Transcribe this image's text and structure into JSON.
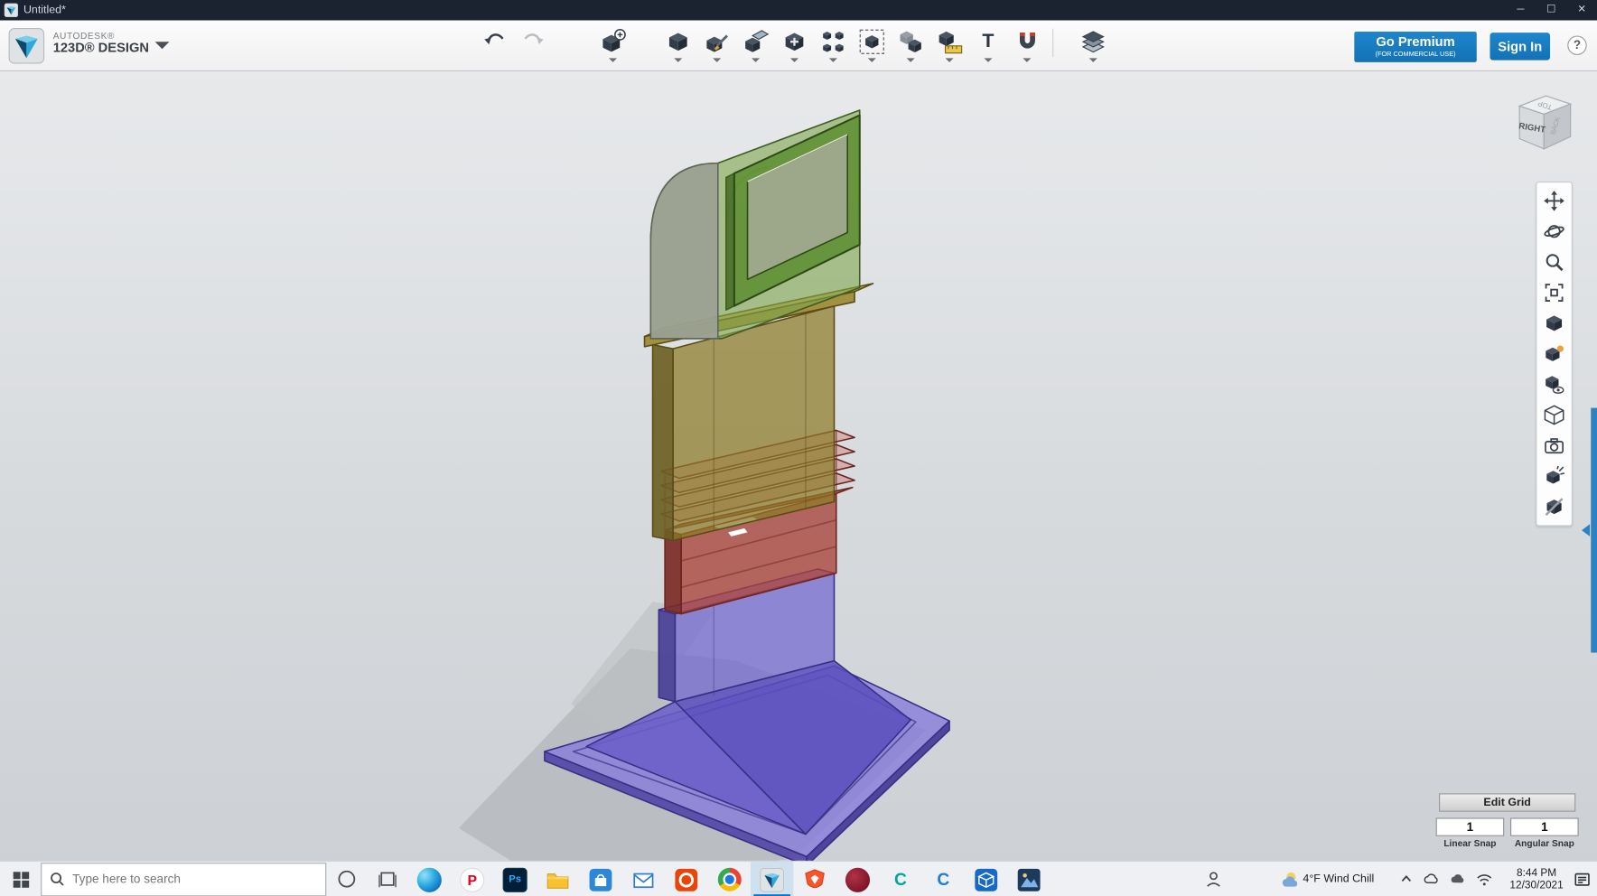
{
  "window": {
    "title": "Untitled*",
    "controls": {
      "minimize": "─",
      "maximize": "☐",
      "close": "✕"
    }
  },
  "brand": {
    "line1": "AUTODESK®",
    "line2": "123D® DESIGN"
  },
  "toolbar": {
    "tools": [
      "undo",
      "redo",
      "transform",
      "primitives",
      "sketch",
      "construct",
      "modify",
      "pattern",
      "grouping",
      "combine",
      "measure",
      "text",
      "snap",
      "material"
    ],
    "text_tool_glyph": "T",
    "go_premium_label": "Go Premium",
    "go_premium_sub": "(FOR COMMERCIAL USE)",
    "sign_in_label": "Sign In",
    "help_label": "?"
  },
  "viewcube": {
    "front": "RIGHT",
    "top": "TOP",
    "side": "BACK"
  },
  "edit_grid": {
    "title": "Edit Grid",
    "linear_value": "1",
    "linear_label": "Linear Snap",
    "angular_value": "1",
    "angular_label": "Angular Snap"
  },
  "taskbar": {
    "search_placeholder": "Type here to search",
    "apps": [
      {
        "name": "edge"
      },
      {
        "name": "pinterest",
        "glyph": "P"
      },
      {
        "name": "photoshop",
        "glyph": "Ps"
      },
      {
        "name": "file-explorer"
      },
      {
        "name": "store"
      },
      {
        "name": "mail"
      },
      {
        "name": "app-orange"
      },
      {
        "name": "chrome"
      },
      {
        "name": "123d-design",
        "active": true
      },
      {
        "name": "app-red-shield"
      },
      {
        "name": "app-maroon"
      },
      {
        "name": "app-teal",
        "glyph": "C"
      },
      {
        "name": "app-blue",
        "glyph": "C"
      },
      {
        "name": "app-cube"
      },
      {
        "name": "photos"
      }
    ],
    "tray": {
      "weather": "4°F  Wind Chill",
      "time": "8:44 PM",
      "date": "12/30/2021"
    }
  }
}
